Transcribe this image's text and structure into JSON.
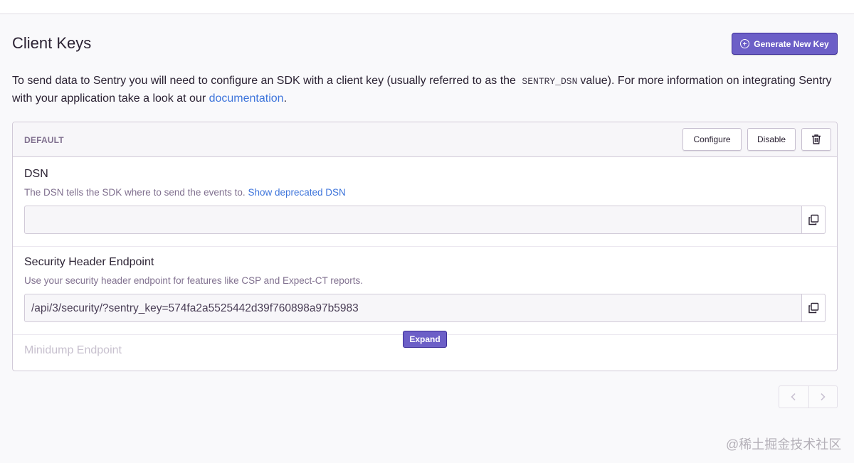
{
  "header": {
    "title": "Client Keys",
    "generate_button_label": "Generate New Key"
  },
  "intro": {
    "text_before_code": "To send data to Sentry you will need to configure an SDK with a client key (usually referred to as the",
    "code": "SENTRY_DSN",
    "text_after_code": "value). For more information on integrating Sentry with your application take a look at our",
    "link_text": "documentation",
    "text_end": "."
  },
  "key_panel": {
    "name": "DEFAULT",
    "buttons": {
      "configure": "Configure",
      "disable": "Disable"
    },
    "dsn": {
      "label": "DSN",
      "help": "The DSN tells the SDK where to send the events to.",
      "help_link": "Show deprecated DSN",
      "value": ""
    },
    "security_endpoint": {
      "label": "Security Header Endpoint",
      "help": "Use your security header endpoint for features like CSP and Expect-CT reports.",
      "value": "/api/3/security/?sentry_key=574fa2a5525442d39f760898a97b5983"
    },
    "minidump": {
      "label": "Minidump Endpoint"
    },
    "expand_label": "Expand"
  },
  "watermark": "@稀土掘金技术社区",
  "colors": {
    "accent": "#6c5fc7",
    "link": "#3d74db",
    "muted": "#80708f"
  }
}
